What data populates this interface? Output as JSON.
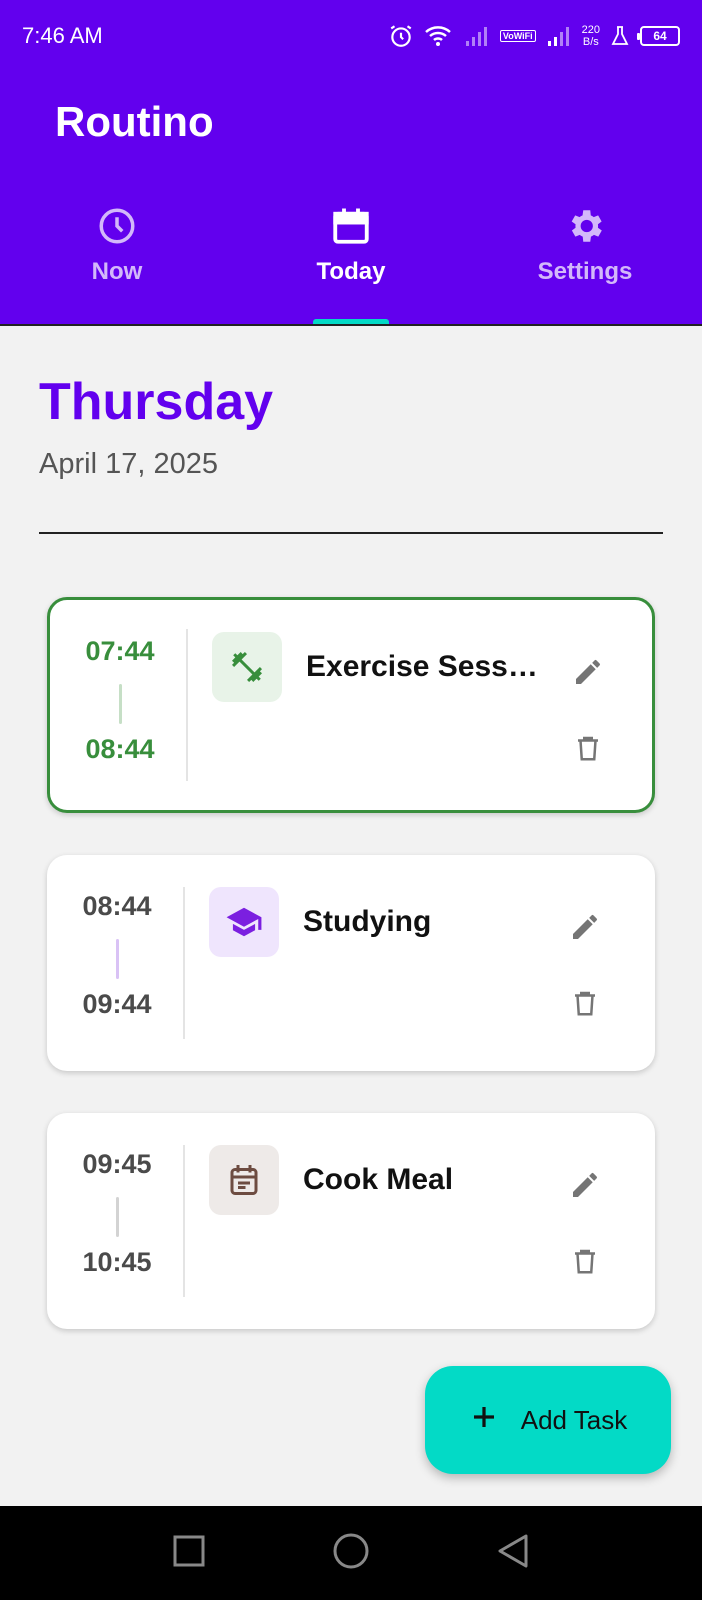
{
  "status_bar": {
    "time": "7:46 AM",
    "vowifi": "VoWiFi",
    "speed_value": "220",
    "speed_unit": "B/s",
    "battery": "64"
  },
  "app": {
    "title": "Routino"
  },
  "tabs": [
    {
      "label": "Now",
      "icon": "clock-icon",
      "active": false
    },
    {
      "label": "Today",
      "icon": "calendar-icon",
      "active": true
    },
    {
      "label": "Settings",
      "icon": "gear-icon",
      "active": false
    }
  ],
  "day": {
    "name": "Thursday",
    "date": "April 17, 2025"
  },
  "tasks": [
    {
      "start": "07:44",
      "end": "08:44",
      "title": "Exercise Sessi…",
      "icon": "dumbbell-icon",
      "accent": "#388e3c",
      "icon_bg": "#e8f3e8",
      "active": true
    },
    {
      "start": "08:44",
      "end": "09:44",
      "title": "Studying",
      "icon": "graduation-cap-icon",
      "accent": "#7b1fe0",
      "icon_bg": "#efe5fd",
      "active": false
    },
    {
      "start": "09:45",
      "end": "10:45",
      "title": "Cook Meal",
      "icon": "event-note-icon",
      "accent": "#6d4c41",
      "icon_bg": "#eeeae8",
      "active": false
    }
  ],
  "fab": {
    "label": "Add Task"
  },
  "colors": {
    "primary": "#6200ee",
    "accent": "#03dac6",
    "active_border": "#388e3c"
  }
}
